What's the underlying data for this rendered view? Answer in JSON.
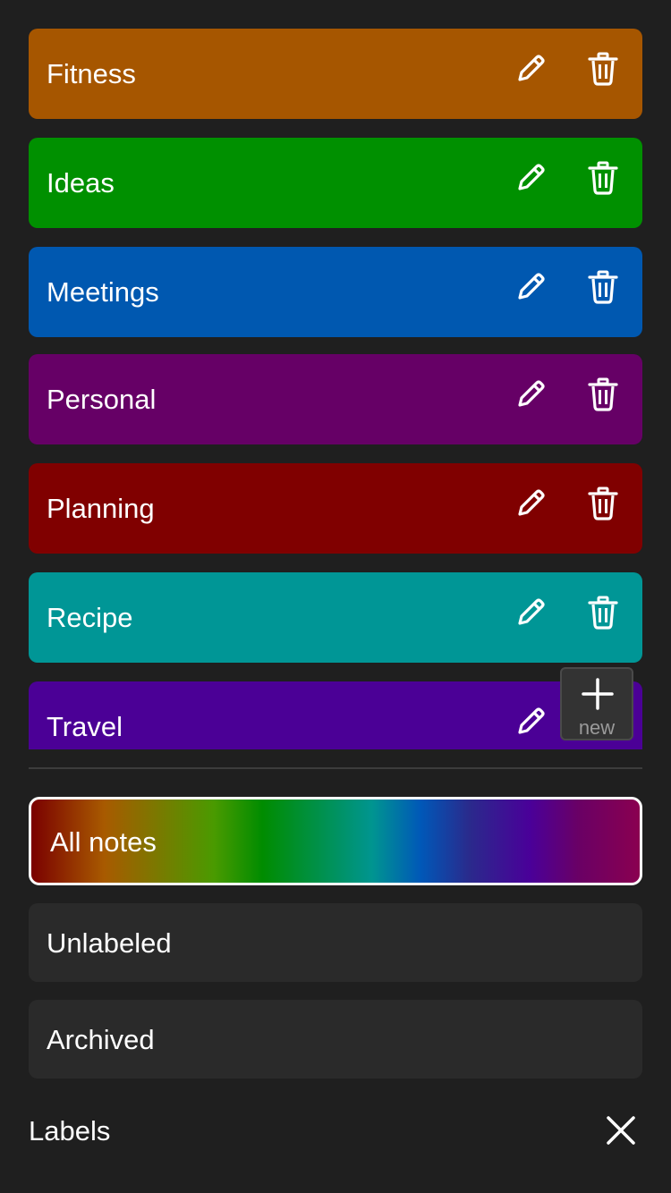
{
  "labels": [
    {
      "name": "Fitness",
      "color": "#a65600"
    },
    {
      "name": "Ideas",
      "color": "#009000"
    },
    {
      "name": "Meetings",
      "color": "#0058b0"
    },
    {
      "name": "Personal",
      "color": "#660066"
    },
    {
      "name": "Planning",
      "color": "#800000"
    },
    {
      "name": "Recipe",
      "color": "#009696"
    },
    {
      "name": "Travel",
      "color": "#4b0096"
    }
  ],
  "new_button": {
    "label": "new"
  },
  "filters": {
    "all_notes": "All notes",
    "unlabeled": "Unlabeled",
    "archived": "Archived"
  },
  "footer": {
    "title": "Labels"
  },
  "icons": {
    "edit": "pencil-icon",
    "delete": "trash-icon",
    "add": "plus-icon",
    "close": "close-icon"
  }
}
